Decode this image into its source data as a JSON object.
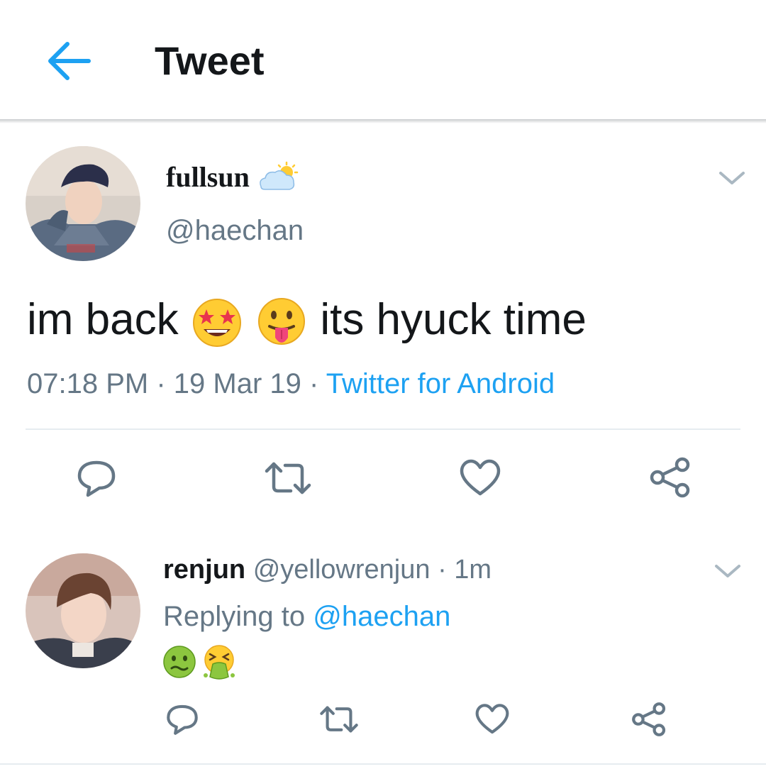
{
  "header": {
    "title": "Tweet"
  },
  "tweet": {
    "display_name": "fullsun",
    "handle": "@haechan",
    "text_before": "im back",
    "text_after": "its hyuck time",
    "time": "07:18 PM",
    "separator": "·",
    "date": "19 Mar 19",
    "source": "Twitter for Android"
  },
  "reply": {
    "display_name": "renjun",
    "handle": "@yellowrenjun",
    "separator": "·",
    "age": "1m",
    "replying_label": "Replying to",
    "replying_to": "@haechan"
  },
  "icons": {
    "back": "arrow-left-icon",
    "menu": "chevron-down-icon",
    "reply": "comment-icon",
    "retweet": "retweet-icon",
    "like": "heart-icon",
    "share": "share-icon",
    "badge": "sun-behind-cloud-icon",
    "emoji": [
      "star-struck-emoji",
      "tongue-out-emoji",
      "nauseated-face-emoji",
      "vomiting-face-emoji"
    ]
  },
  "colors": {
    "accent": "#1da1f2",
    "secondary_text": "#657786",
    "primary_text": "#14171a",
    "icon": "#657786",
    "divider": "#e6ecf0"
  }
}
